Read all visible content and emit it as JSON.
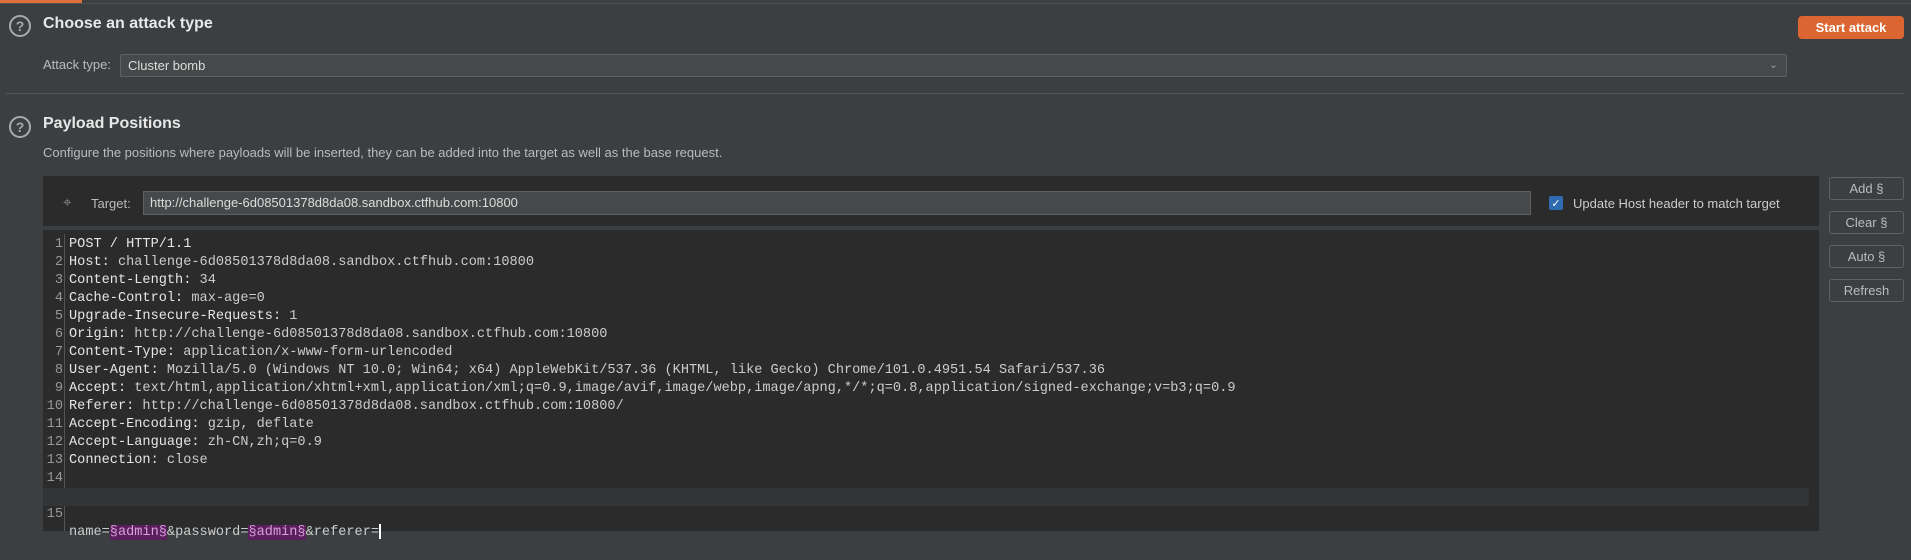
{
  "attack_type_section": {
    "title": "Choose an attack type",
    "label": "Attack type:",
    "value": "Cluster bomb",
    "start_button": "Start attack"
  },
  "positions_section": {
    "title": "Payload Positions",
    "description": "Configure the positions where payloads will be inserted, they can be added into the target as well as the base request.",
    "target_label": "Target:",
    "target_value": "http://challenge-6d08501378d8da08.sandbox.ctfhub.com:10800",
    "update_host_label": "Update Host header to match target",
    "update_host_checked": true,
    "buttons": {
      "add": "Add §",
      "clear": "Clear §",
      "auto": "Auto §",
      "refresh": "Refresh"
    }
  },
  "request": {
    "lines": [
      {
        "n": "1",
        "key": "POST / HTTP/1.1",
        "val": ""
      },
      {
        "n": "2",
        "key": "Host:",
        "val": " challenge-6d08501378d8da08.sandbox.ctfhub.com:10800"
      },
      {
        "n": "3",
        "key": "Content-Length:",
        "val": " 34"
      },
      {
        "n": "4",
        "key": "Cache-Control:",
        "val": " max-age=0"
      },
      {
        "n": "5",
        "key": "Upgrade-Insecure-Requests:",
        "val": " 1"
      },
      {
        "n": "6",
        "key": "Origin:",
        "val": " http://challenge-6d08501378d8da08.sandbox.ctfhub.com:10800"
      },
      {
        "n": "7",
        "key": "Content-Type:",
        "val": " application/x-www-form-urlencoded"
      },
      {
        "n": "8",
        "key": "User-Agent:",
        "val": " Mozilla/5.0 (Windows NT 10.0; Win64; x64) AppleWebKit/537.36 (KHTML, like Gecko) Chrome/101.0.4951.54 Safari/537.36"
      },
      {
        "n": "9",
        "key": "Accept:",
        "val": " text/html,application/xhtml+xml,application/xml;q=0.9,image/avif,image/webp,image/apng,*/*;q=0.8,application/signed-exchange;v=b3;q=0.9"
      },
      {
        "n": "10",
        "key": "Referer:",
        "val": " http://challenge-6d08501378d8da08.sandbox.ctfhub.com:10800/"
      },
      {
        "n": "11",
        "key": "Accept-Encoding:",
        "val": " gzip, deflate"
      },
      {
        "n": "12",
        "key": "Accept-Language:",
        "val": " zh-CN,zh;q=0.9"
      },
      {
        "n": "13",
        "key": "Connection:",
        "val": " close"
      },
      {
        "n": "14",
        "key": "",
        "val": ""
      }
    ],
    "body": {
      "n": "15",
      "p1": "name=",
      "m1": "§admin§",
      "p2": "&password=",
      "m2": "§admin§",
      "p3": "&referer="
    }
  },
  "colors": {
    "accent": "#db6631",
    "payload_marker_bg": "#5a1f5c",
    "checkbox": "#2f6bb0"
  }
}
